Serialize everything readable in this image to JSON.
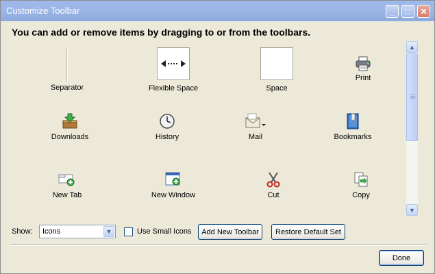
{
  "window": {
    "title": "Customize Toolbar"
  },
  "titlebar_buttons": {
    "minimize": "_",
    "maximize": "□",
    "close": "✕"
  },
  "headline": "You can add or remove items by dragging to or from the toolbars.",
  "items": [
    {
      "label": "Separator",
      "icon": "separator-icon"
    },
    {
      "label": "Flexible Space",
      "icon": "flexible-space-icon"
    },
    {
      "label": "Space",
      "icon": "space-icon"
    },
    {
      "label": "Print",
      "icon": "printer-icon"
    },
    {
      "label": "Downloads",
      "icon": "downloads-icon"
    },
    {
      "label": "History",
      "icon": "clock-icon"
    },
    {
      "label": "Mail",
      "icon": "mail-icon"
    },
    {
      "label": "Bookmarks",
      "icon": "bookmarks-icon"
    },
    {
      "label": "New Tab",
      "icon": "new-tab-icon"
    },
    {
      "label": "New Window",
      "icon": "new-window-icon"
    },
    {
      "label": "Cut",
      "icon": "scissors-icon"
    },
    {
      "label": "Copy",
      "icon": "copy-icon"
    }
  ],
  "scrollbar": {
    "up": "▲",
    "down": "▼"
  },
  "controls": {
    "show_label": "Show:",
    "show_value": "Icons",
    "dropdown_arrow": "▼",
    "use_small_icons": "Use Small Icons",
    "use_small_icons_checked": false,
    "add_new_toolbar": "Add New Toolbar",
    "restore_default_set": "Restore Default Set",
    "done": "Done"
  },
  "colors": {
    "title_bar": "#9DB9EB",
    "dialog_bg": "#ECE9D8",
    "button_border": "#003C74"
  }
}
